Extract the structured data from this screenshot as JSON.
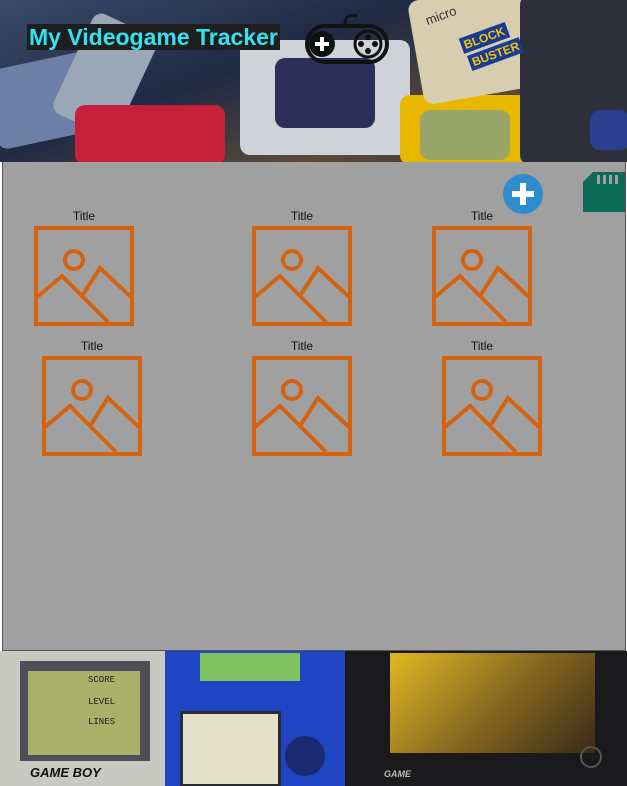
{
  "header": {
    "title": "My Videogame Tracker",
    "banner_text": [
      "BLOCK",
      "BUSTER",
      "micro"
    ]
  },
  "toolbar": {
    "add_icon": "plus-circle-icon",
    "sd_icon": "sd-card-icon",
    "add_color": "#2e8ccf",
    "sd_color": "#0b6b57"
  },
  "games": [
    {
      "title": "Title"
    },
    {
      "title": "Title"
    },
    {
      "title": "Title"
    },
    {
      "title": "Title"
    },
    {
      "title": "Title"
    },
    {
      "title": "Title"
    }
  ],
  "placeholder_icon": "image-placeholder-icon",
  "placeholder_color": "#d4620f",
  "footer": {
    "gameboy_text": "GAME BOY",
    "screen_text": [
      "SCORE",
      "LEVEL",
      "LINES"
    ],
    "psp_text": "GAME"
  }
}
